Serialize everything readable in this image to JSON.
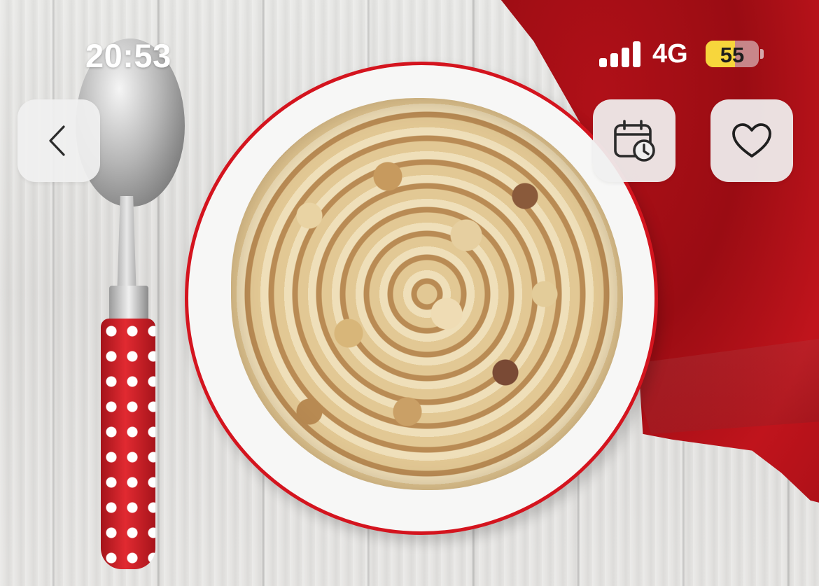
{
  "status_bar": {
    "time": "20:53",
    "network": "4G",
    "battery_percent": "55",
    "battery_level": 0.55,
    "signal_bars": 4
  },
  "toolbar": {
    "back_icon": "chevron-left-icon",
    "calendar_icon": "calendar-clock-icon",
    "favorite_icon": "heart-outline-icon"
  },
  "hero_image": {
    "subject": "bowl-of-cereal-with-spoon-photo"
  },
  "colors": {
    "battery_fill": "#f7d63c",
    "button_bg": "#f0f0f0",
    "icon_stroke": "#2b2b2b"
  }
}
